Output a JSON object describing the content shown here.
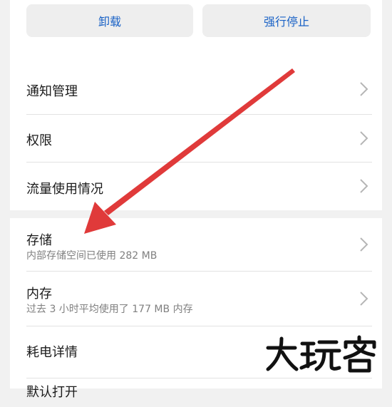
{
  "actions": {
    "uninstall_label": "卸载",
    "force_stop_label": "强行停止"
  },
  "settings": {
    "notifications": {
      "title": "通知管理"
    },
    "permissions": {
      "title": "权限"
    },
    "data_usage": {
      "title": "流量使用情况"
    },
    "storage": {
      "title": "存储",
      "subtitle": "内部存储空间已使用 282 MB"
    },
    "memory": {
      "title": "内存",
      "subtitle": "过去 3 小时平均使用了 177 MB 内存"
    },
    "battery": {
      "title": "耗电详情"
    },
    "open_by_default": {
      "title": "默认打开"
    }
  },
  "watermark": {
    "text": "大玩客"
  },
  "colors": {
    "accent": "#1a62c6",
    "annotation_arrow": "#e03a3a",
    "background": "#f1f1f1",
    "card": "#ffffff"
  },
  "icons": {
    "chevron": "chevron-right-icon"
  }
}
